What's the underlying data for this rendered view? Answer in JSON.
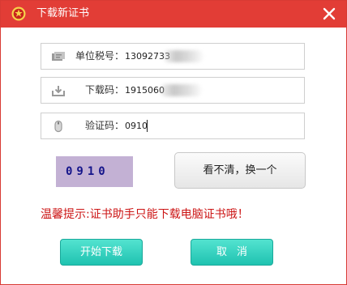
{
  "window": {
    "title": "下载新证书",
    "close_icon": "close-icon",
    "logo_icon": "tax-emblem-icon",
    "titlebar_color": "#e23d36"
  },
  "fields": {
    "tax_id": {
      "label": "单位税号：",
      "value": "13092733",
      "icon": "card-icon"
    },
    "download_code": {
      "label": "下载码：",
      "value": "1915060",
      "icon": "download-icon"
    },
    "verify_code": {
      "label": "验证码：",
      "value": "0910",
      "icon": "mouse-icon"
    }
  },
  "captcha": {
    "text": "0910",
    "background": "#c3b1d4"
  },
  "refresh_button": {
    "label": "看不清，换一个"
  },
  "warning": {
    "text": "温馨提示:证书助手只能下载电脑证书哦！",
    "color": "#cc1515"
  },
  "buttons": {
    "start_label": "开始下载",
    "cancel_label": "取消",
    "accent": "#1fc2b0"
  }
}
